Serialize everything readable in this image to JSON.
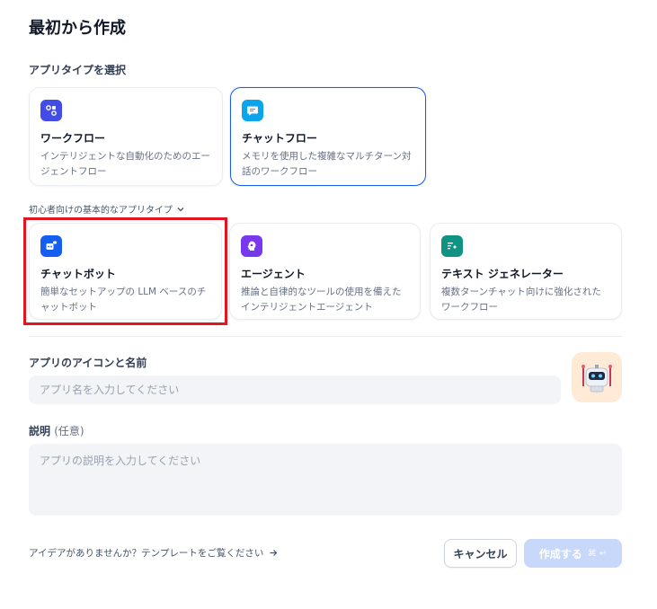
{
  "title": "最初から作成",
  "app_type_label": "アプリタイプを選択",
  "app_types": [
    {
      "name": "ワークフロー",
      "desc": "インテリジェントな自動化のためのエージェントフロー",
      "icon": "workflow-icon",
      "color": "#444ce7"
    },
    {
      "name": "チャットフロー",
      "desc": "メモリを使用した複雑なマルチターン対話のワークフロー",
      "icon": "chatflow-icon",
      "color": "#0ba5ec"
    }
  ],
  "beginner_label": "初心者向けの基本的なアプリタイプ",
  "beginner_types": [
    {
      "name": "チャットボット",
      "desc": "簡単なセットアップの LLM ベースのチャットボット",
      "icon": "chatbot-icon",
      "color": "#155eef"
    },
    {
      "name": "エージェント",
      "desc": "推論と自律的なツールの使用を備えたインテリジェントエージェント",
      "icon": "agent-icon",
      "color": "#7839ee"
    },
    {
      "name": "テキスト ジェネレーター",
      "desc": "複数ターンチャット向けに強化されたワークフロー",
      "icon": "text-generator-icon",
      "color": "#0e9384"
    }
  ],
  "name_field": {
    "label": "アプリのアイコンと名前",
    "placeholder": "アプリ名を入力してください",
    "value": ""
  },
  "desc_field": {
    "label": "説明",
    "optional": "(任意)",
    "placeholder": "アプリの説明を入力してください",
    "value": ""
  },
  "avatar": {
    "icon": "robot-icon",
    "bg": "#ffead5"
  },
  "footer": {
    "idea_text": "アイデアがありませんか？テンプレートをご覧ください",
    "cancel_label": "キャンセル",
    "create_label": "作成する",
    "create_shortcut": "⌘ ↵"
  }
}
